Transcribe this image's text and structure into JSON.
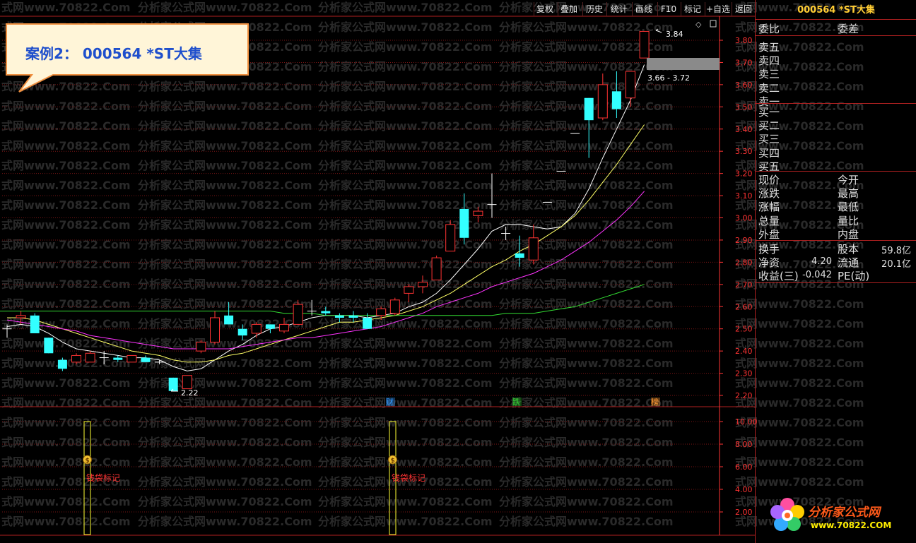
{
  "toolbar": {
    "buttons": [
      {
        "id": "fuquan",
        "label": "复权"
      },
      {
        "id": "diejia",
        "label": "叠加"
      },
      {
        "id": "lishi",
        "label": "历史"
      },
      {
        "id": "tongji",
        "label": "统计"
      },
      {
        "id": "huaxian",
        "label": "画线"
      },
      {
        "id": "f10",
        "label": "F10"
      },
      {
        "id": "biaoji",
        "label": "标记"
      },
      {
        "id": "zixuan",
        "label": "+自选"
      },
      {
        "id": "fanhui",
        "label": "返回"
      }
    ]
  },
  "callout": {
    "text": "案例2： 000564 *ST大集"
  },
  "watermark": {
    "text": "分析家公式网www.70822.Com",
    "short_text": "式网www.70822.Com"
  },
  "chart_data": {
    "type": "candlestick",
    "price_axis": {
      "min": 2.2,
      "max": 3.8,
      "ticks": [
        "3.80",
        "3.70",
        "3.60",
        "3.50",
        "3.40",
        "3.30",
        "3.20",
        "3.10",
        "3.00",
        "2.90",
        "2.80",
        "2.70",
        "2.60",
        "2.50",
        "2.40",
        "2.30",
        "2.20"
      ]
    },
    "candles": [
      {
        "o": 2.5,
        "h": 2.52,
        "l": 2.46,
        "c": 2.5
      },
      {
        "o": 2.55,
        "h": 2.58,
        "l": 2.52,
        "c": 2.56
      },
      {
        "o": 2.56,
        "h": 2.57,
        "l": 2.48,
        "c": 2.48
      },
      {
        "o": 2.46,
        "h": 2.46,
        "l": 2.39,
        "c": 2.39
      },
      {
        "o": 2.36,
        "h": 2.37,
        "l": 2.31,
        "c": 2.32
      },
      {
        "o": 2.35,
        "h": 2.39,
        "l": 2.34,
        "c": 2.38
      },
      {
        "o": 2.35,
        "h": 2.4,
        "l": 2.35,
        "c": 2.39
      },
      {
        "o": 2.37,
        "h": 2.4,
        "l": 2.34,
        "c": 2.37
      },
      {
        "o": 2.37,
        "h": 2.38,
        "l": 2.35,
        "c": 2.36
      },
      {
        "o": 2.35,
        "h": 2.38,
        "l": 2.35,
        "c": 2.38
      },
      {
        "o": 2.37,
        "h": 2.38,
        "l": 2.35,
        "c": 2.35
      },
      {
        "o": 2.35,
        "h": 2.36,
        "l": 2.34,
        "c": 2.35
      },
      {
        "o": 2.28,
        "h": 2.28,
        "l": 2.22,
        "c": 2.22
      },
      {
        "o": 2.23,
        "h": 2.29,
        "l": 2.23,
        "c": 2.29
      },
      {
        "o": 2.4,
        "h": 2.45,
        "l": 2.39,
        "c": 2.44
      },
      {
        "o": 2.44,
        "h": 2.58,
        "l": 2.43,
        "c": 2.55
      },
      {
        "o": 2.56,
        "h": 2.62,
        "l": 2.53,
        "c": 2.52
      },
      {
        "o": 2.5,
        "h": 2.52,
        "l": 2.45,
        "c": 2.47
      },
      {
        "o": 2.48,
        "h": 2.53,
        "l": 2.46,
        "c": 2.52
      },
      {
        "o": 2.52,
        "h": 2.52,
        "l": 2.48,
        "c": 2.5
      },
      {
        "o": 2.49,
        "h": 2.55,
        "l": 2.48,
        "c": 2.52
      },
      {
        "o": 2.52,
        "h": 2.63,
        "l": 2.52,
        "c": 2.61
      },
      {
        "o": 2.58,
        "h": 2.63,
        "l": 2.56,
        "c": 2.58
      },
      {
        "o": 2.58,
        "h": 2.6,
        "l": 2.56,
        "c": 2.57
      },
      {
        "o": 2.56,
        "h": 2.57,
        "l": 2.53,
        "c": 2.55
      },
      {
        "o": 2.56,
        "h": 2.58,
        "l": 2.53,
        "c": 2.55
      },
      {
        "o": 2.55,
        "h": 2.57,
        "l": 2.5,
        "c": 2.5
      },
      {
        "o": 2.56,
        "h": 2.6,
        "l": 2.54,
        "c": 2.59
      },
      {
        "o": 2.57,
        "h": 2.64,
        "l": 2.56,
        "c": 2.63
      },
      {
        "o": 2.66,
        "h": 2.7,
        "l": 2.62,
        "c": 2.69
      },
      {
        "o": 2.69,
        "h": 2.74,
        "l": 2.66,
        "c": 2.71
      },
      {
        "o": 2.72,
        "h": 2.83,
        "l": 2.72,
        "c": 2.82
      },
      {
        "o": 2.85,
        "h": 2.99,
        "l": 2.85,
        "c": 2.97
      },
      {
        "o": 3.04,
        "h": 3.11,
        "l": 2.88,
        "c": 2.91
      },
      {
        "o": 3.01,
        "h": 3.05,
        "l": 2.98,
        "c": 3.03
      },
      {
        "o": 3.06,
        "h": 3.2,
        "l": 3.0,
        "c": 3.06
      },
      {
        "o": 2.93,
        "h": 2.96,
        "l": 2.9,
        "c": 2.93
      },
      {
        "o": 2.84,
        "h": 2.92,
        "l": 2.78,
        "c": 2.82
      },
      {
        "o": 2.81,
        "h": 2.97,
        "l": 2.79,
        "c": 2.91
      },
      {
        "o": 3.07,
        "h": 3.07,
        "l": 3.07,
        "c": 3.07
      },
      {
        "o": 3.21,
        "h": 3.21,
        "l": 3.21,
        "c": 3.21
      },
      {
        "o": 3.38,
        "h": 3.38,
        "l": 3.38,
        "c": 3.38
      },
      {
        "o": 3.54,
        "h": 3.54,
        "l": 3.27,
        "c": 3.44
      },
      {
        "o": 3.45,
        "h": 3.65,
        "l": 3.44,
        "c": 3.6
      },
      {
        "o": 3.57,
        "h": 3.66,
        "l": 3.45,
        "c": 3.49
      },
      {
        "o": 3.54,
        "h": 3.66,
        "l": 3.5,
        "c": 3.66
      },
      {
        "o": 3.72,
        "h": 3.84,
        "l": 3.72,
        "c": 3.84
      }
    ],
    "ma_series": [
      {
        "color": "#ffffff",
        "values": [
          2.51,
          2.52,
          2.51,
          2.48,
          2.44,
          2.41,
          2.4,
          2.39,
          2.38,
          2.37,
          2.37,
          2.36,
          2.33,
          2.31,
          2.32,
          2.36,
          2.4,
          2.43,
          2.47,
          2.5,
          2.51,
          2.53,
          2.55,
          2.56,
          2.56,
          2.56,
          2.55,
          2.56,
          2.57,
          2.6,
          2.62,
          2.66,
          2.72,
          2.79,
          2.86,
          2.94,
          2.97,
          2.97,
          2.96,
          2.95,
          2.96,
          3.02,
          3.13,
          3.27,
          3.4,
          3.53,
          3.69
        ]
      },
      {
        "color": "#ffff66",
        "values": [
          2.55,
          2.55,
          2.54,
          2.52,
          2.5,
          2.48,
          2.46,
          2.44,
          2.42,
          2.4,
          2.39,
          2.38,
          2.36,
          2.35,
          2.35,
          2.36,
          2.38,
          2.39,
          2.41,
          2.43,
          2.45,
          2.47,
          2.49,
          2.51,
          2.53,
          2.53,
          2.54,
          2.55,
          2.56,
          2.58,
          2.6,
          2.63,
          2.66,
          2.7,
          2.74,
          2.78,
          2.81,
          2.85,
          2.88,
          2.92,
          2.96,
          3.01,
          3.08,
          3.16,
          3.24,
          3.33,
          3.42
        ]
      },
      {
        "color": "#ff33ff",
        "values": [
          2.54,
          2.53,
          2.52,
          2.51,
          2.5,
          2.49,
          2.47,
          2.46,
          2.45,
          2.44,
          2.43,
          2.42,
          2.41,
          2.41,
          2.41,
          2.41,
          2.41,
          2.42,
          2.43,
          2.44,
          2.45,
          2.46,
          2.46,
          2.47,
          2.48,
          2.49,
          2.5,
          2.51,
          2.53,
          2.55,
          2.57,
          2.6,
          2.62,
          2.64,
          2.66,
          2.69,
          2.71,
          2.73,
          2.75,
          2.78,
          2.81,
          2.85,
          2.89,
          2.94,
          2.99,
          3.05,
          3.12
        ]
      },
      {
        "color": "#33dd33",
        "values": [
          2.58,
          2.58,
          2.58,
          2.58,
          2.58,
          2.58,
          2.58,
          2.58,
          2.58,
          2.58,
          2.58,
          2.58,
          2.58,
          2.58,
          2.58,
          2.58,
          2.58,
          2.58,
          2.58,
          2.58,
          2.57,
          2.57,
          2.57,
          2.56,
          2.56,
          2.56,
          2.56,
          2.56,
          2.56,
          2.56,
          2.56,
          2.56,
          2.56,
          2.56,
          2.56,
          2.56,
          2.57,
          2.57,
          2.57,
          2.58,
          2.59,
          2.6,
          2.62,
          2.64,
          2.66,
          2.68,
          2.7
        ]
      }
    ],
    "annotations": [
      {
        "text": "3.84"
      },
      {
        "text": "3.66 - 3.72"
      },
      {
        "text": "2.22"
      }
    ],
    "event_markers": [
      {
        "label": "财",
        "color": "#3399ff"
      },
      {
        "label": "跌",
        "color": "#33cc33"
      },
      {
        "label": "榜",
        "color": "#ff9933"
      }
    ],
    "indicator_axis": {
      "min": 0,
      "max": 10.0,
      "ticks": [
        "10.00",
        "8.00",
        "6.00",
        "4.00",
        "2.00"
      ]
    },
    "indicator_bars": [
      {
        "label": "钱袋标记"
      },
      {
        "label": "钱袋标记"
      }
    ]
  },
  "quote_panel": {
    "title": "000564 *ST大集",
    "weibi_label": "委比",
    "weicha_label": "委差",
    "sell": [
      "卖五",
      "卖四",
      "卖三",
      "卖二",
      "卖一"
    ],
    "buy": [
      "买一",
      "买二",
      "买三",
      "买四",
      "买五"
    ],
    "stats_left": [
      "现价",
      "涨跌",
      "涨幅",
      "总量",
      "外盘"
    ],
    "stats_right": [
      "今开",
      "最高",
      "最低",
      "量比",
      "内盘"
    ],
    "fin": [
      {
        "l1": "换手",
        "v1": "",
        "l2": "股本",
        "v2": "59.8亿"
      },
      {
        "l1": "净资",
        "v1": "4.20",
        "l2": "流通",
        "v2": "20.1亿"
      },
      {
        "l1": "收益(三)",
        "v1": "-0.042",
        "l2": "PE(动)",
        "v2": ""
      }
    ]
  },
  "logo": {
    "text": "分析家公式网",
    "url": "www.70822.COM"
  },
  "colors": {
    "up": "#ff3333",
    "down": "#33ffff",
    "grid": "#7a1515",
    "axis": "#ff3333",
    "label": "#ff3333"
  }
}
